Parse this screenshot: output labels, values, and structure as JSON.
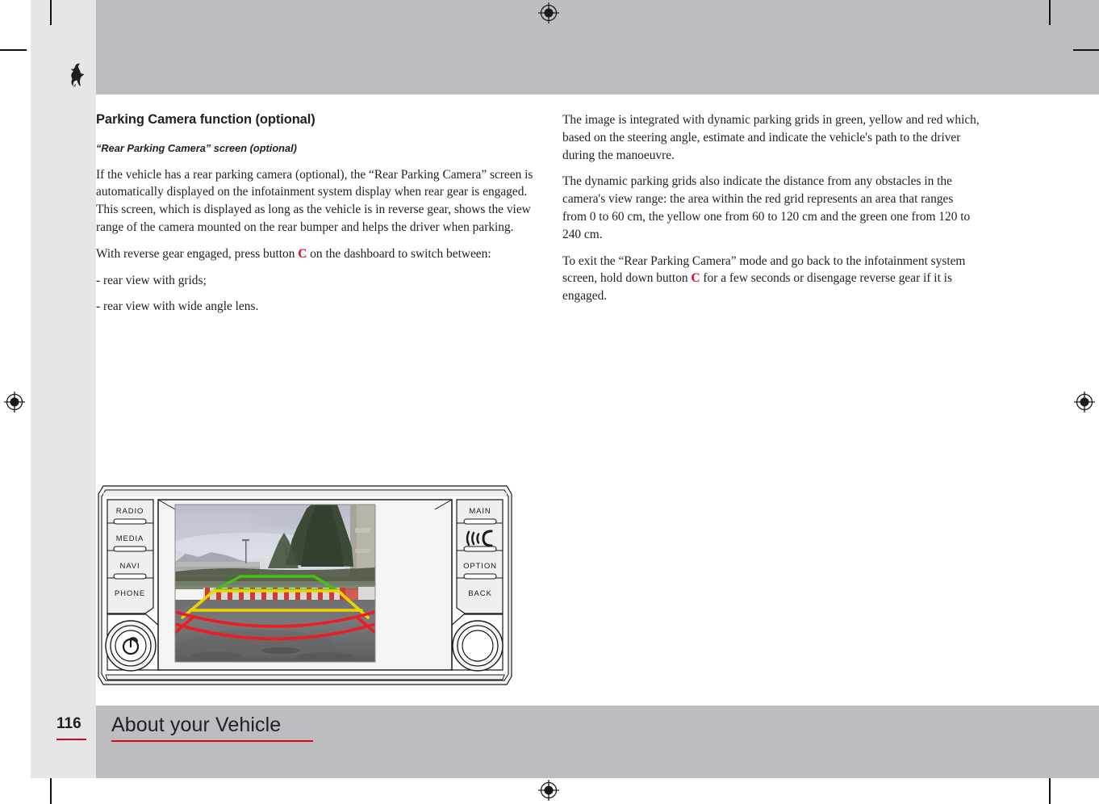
{
  "page": {
    "number": "116",
    "footer_title": "About your Vehicle",
    "accent_color": "#e2001a",
    "header_band_color": "#bcbdc1",
    "margin_color": "#e5e6e8",
    "logo_name": "ferrari-prancing-horse"
  },
  "content": {
    "section_title": "Parking Camera function (optional)",
    "subsection_title": "“Rear Parking Camera” screen (optional)",
    "left_column": {
      "p1_a": "If the vehicle has a rear parking camera (optional), the “Rear Parking Camera” screen is automatically displayed on the infotainment system display when rear gear is engaged. This screen, which is displayed as long as the vehicle is in reverse gear, shows the view range of the camera mounted on the rear bumper and helps the driver when parking.",
      "p2_before": "With reverse gear engaged, press button ",
      "p2_button": "C",
      "p2_after": " on the dashboard to switch between:",
      "bullet1": "- rear view with grids;",
      "bullet2": "- rear view with wide angle lens."
    },
    "right_column": {
      "p1": "The image is integrated with dynamic parking grids in green, yellow and red which, based on the steering angle, estimate and indicate the vehicle's path to the driver during the manoeuvre.",
      "p2": "The dynamic parking grids also indicate the distance from any obstacles in the camera's view range: the area within the red grid represents an area that ranges from 0 to 60 cm, the yellow one from 60 to 120 cm and the green one from 120 to 240 cm.",
      "p3_before": "To exit the “Rear Parking Camera” mode and go back to the infotainment system screen, hold down button ",
      "p3_button": "C",
      "p3_after": " for a few seconds or disengage reverse gear if it is engaged."
    }
  },
  "figure": {
    "caption": "",
    "device_name": "infotainment-head-unit",
    "left_buttons": [
      {
        "label": "RADIO",
        "name": "radio-button"
      },
      {
        "label": "MEDIA",
        "name": "media-button"
      },
      {
        "label": "NAVI",
        "name": "navi-button"
      },
      {
        "label": "PHONE",
        "name": "phone-button"
      }
    ],
    "right_buttons": [
      {
        "label": "MAIN",
        "name": "main-button"
      },
      {
        "label": "",
        "name": "parking-sensor-icon-button",
        "icon": "parking-sensor-icon"
      },
      {
        "label": "OPTION",
        "name": "option-button"
      },
      {
        "label": "BACK",
        "name": "back-button"
      }
    ],
    "left_knob": {
      "name": "power-volume-knob",
      "icon": "power-icon"
    },
    "right_knob": {
      "name": "tune-knob"
    },
    "screen": {
      "name": "rear-parking-camera-screen",
      "grid_colors": {
        "green": "#46c113",
        "yellow": "#ecd400",
        "red": "#ee1c24"
      }
    }
  }
}
